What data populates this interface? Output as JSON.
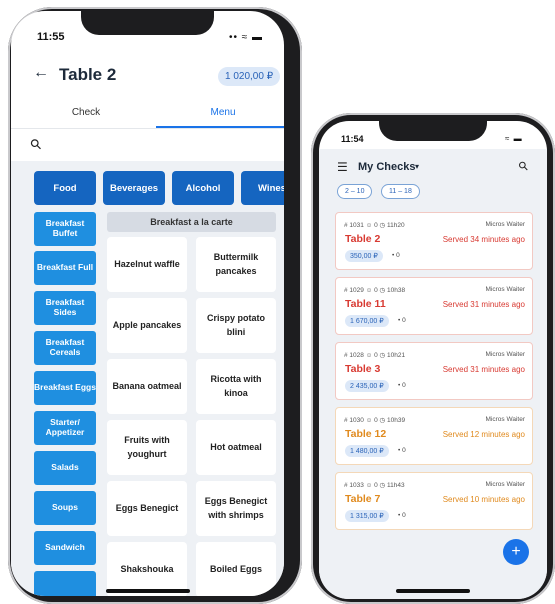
{
  "phone1": {
    "status_time": "11:55",
    "status_icons": "•• ≈ ▬",
    "back_icon": "←",
    "title": "Table 2",
    "total_badge": "1 020,00 ₽",
    "tabs": [
      "Check",
      "Menu"
    ],
    "search_icon": "⚲",
    "categories": [
      "Food",
      "Beverages",
      "Alcohol",
      "Wines"
    ],
    "subcategories": [
      "Breakfast Buffet",
      "Breakfast Full",
      "Breakfast Sides",
      "Breakfast Cereals",
      "Breakfast Eggs",
      "Starter/ Appetizer",
      "Salads",
      "Soups",
      "Sandwich"
    ],
    "section_header": "Breakfast a la carte",
    "items": [
      "Hazelnut waffle",
      "Buttermilk pancakes",
      "Apple pancakes",
      "Crispy potato blini",
      "Banana oatmeal",
      "Ricotta with kinoa",
      "Fruits with youghurt",
      "Hot oatmeal",
      "Eggs Benegict",
      "Eggs Benegict with shrimps",
      "Shakshouka",
      "Boiled Eggs"
    ]
  },
  "phone2": {
    "status_time": "11:54",
    "status_icons": "≈ ▬",
    "title": "My Checks",
    "filters": [
      "2 – 10",
      "11 – 18"
    ],
    "checks": [
      {
        "meta": "# 1031  ☺ 0  ◷ 11h20",
        "waiter": "Micros Waiter",
        "table": "Table 2",
        "served": "Served 34 minutes ago",
        "amount": "350,00 ₽",
        "dot": "• 0",
        "status": "red"
      },
      {
        "meta": "# 1029  ☺ 0  ◷ 10h38",
        "waiter": "Micros Waiter",
        "table": "Table 11",
        "served": "Served 31 minutes ago",
        "amount": "1 670,00 ₽",
        "dot": "• 0",
        "status": "red"
      },
      {
        "meta": "# 1028  ☺ 0  ◷ 10h21",
        "waiter": "Micros Waiter",
        "table": "Table 3",
        "served": "Served 31 minutes ago",
        "amount": "2 435,00 ₽",
        "dot": "• 0",
        "status": "red"
      },
      {
        "meta": "# 1030  ☺ 0  ◷ 10h39",
        "waiter": "Micros Waiter",
        "table": "Table 12",
        "served": "Served 12 minutes ago",
        "amount": "1 480,00 ₽",
        "dot": "• 0",
        "status": "orange"
      },
      {
        "meta": "# 1033  ☺ 0  ◷ 11h43",
        "waiter": "Micros Waiter",
        "table": "Table 7",
        "served": "Served 10 minutes ago",
        "amount": "1 315,00 ₽",
        "dot": "• 0",
        "status": "orange"
      }
    ],
    "fab_icon": "+"
  },
  "colors": {
    "accent": "#1a73e8",
    "category": "#1565c0",
    "subcategory": "#1f8fe0",
    "overdue": "#d83a32",
    "warning": "#e08a1e"
  }
}
